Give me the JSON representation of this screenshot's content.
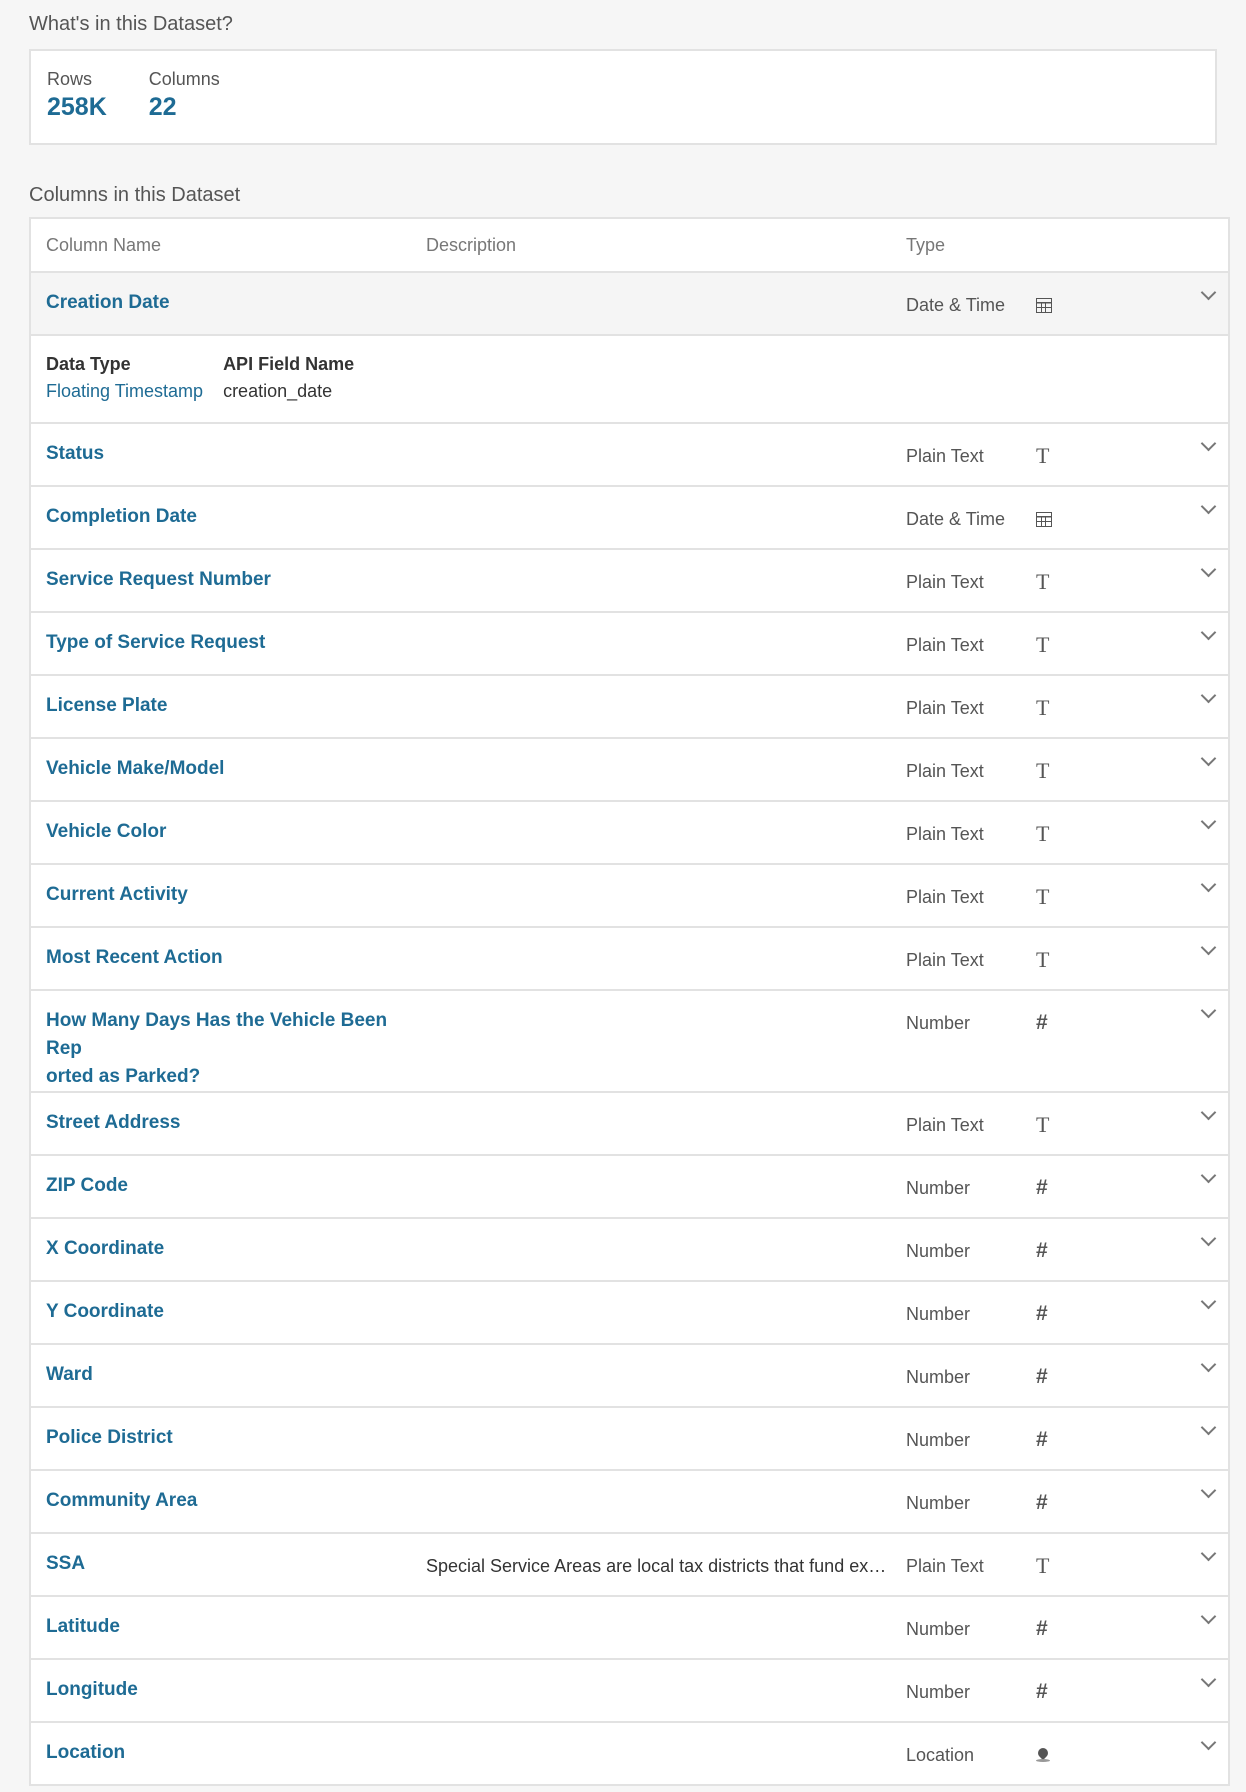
{
  "summary": {
    "heading": "What's in this Dataset?",
    "rows_label": "Rows",
    "rows_value": "258K",
    "columns_label": "Columns",
    "columns_value": "22"
  },
  "columns_section": {
    "heading": "Columns in this Dataset",
    "header": {
      "name": "Column Name",
      "description": "Description",
      "type": "Type"
    },
    "expanded_detail": {
      "data_type_label": "Data Type",
      "data_type_value": "Floating Timestamp",
      "api_field_label": "API Field Name",
      "api_field_value": "creation_date"
    },
    "rows": [
      {
        "name": "Creation Date",
        "description": "",
        "type": "Date & Time",
        "icon": "calendar-icon"
      },
      {
        "name": "Status",
        "description": "",
        "type": "Plain Text",
        "icon": "text-icon"
      },
      {
        "name": "Completion Date",
        "description": "",
        "type": "Date & Time",
        "icon": "calendar-icon"
      },
      {
        "name": "Service Request Number",
        "description": "",
        "type": "Plain Text",
        "icon": "text-icon"
      },
      {
        "name": "Type of Service Request",
        "description": "",
        "type": "Plain Text",
        "icon": "text-icon"
      },
      {
        "name": "License Plate",
        "description": "",
        "type": "Plain Text",
        "icon": "text-icon"
      },
      {
        "name": "Vehicle Make/Model",
        "description": "",
        "type": "Plain Text",
        "icon": "text-icon"
      },
      {
        "name": "Vehicle Color",
        "description": "",
        "type": "Plain Text",
        "icon": "text-icon"
      },
      {
        "name": "Current Activity",
        "description": "",
        "type": "Plain Text",
        "icon": "text-icon"
      },
      {
        "name": "Most Recent Action",
        "description": "",
        "type": "Plain Text",
        "icon": "text-icon"
      },
      {
        "name": "How Many Days Has the Vehicle Been Rep orted as Parked?",
        "name_line1": "How Many Days Has the Vehicle Been Rep",
        "name_line2": "orted as Parked?",
        "description": "",
        "type": "Number",
        "icon": "hash-icon"
      },
      {
        "name": "Street Address",
        "description": "",
        "type": "Plain Text",
        "icon": "text-icon"
      },
      {
        "name": "ZIP Code",
        "description": "",
        "type": "Number",
        "icon": "hash-icon"
      },
      {
        "name": "X Coordinate",
        "description": "",
        "type": "Number",
        "icon": "hash-icon"
      },
      {
        "name": "Y Coordinate",
        "description": "",
        "type": "Number",
        "icon": "hash-icon"
      },
      {
        "name": "Ward",
        "description": "",
        "type": "Number",
        "icon": "hash-icon"
      },
      {
        "name": "Police District",
        "description": "",
        "type": "Number",
        "icon": "hash-icon"
      },
      {
        "name": "Community Area",
        "description": "",
        "type": "Number",
        "icon": "hash-icon"
      },
      {
        "name": "SSA",
        "description": "Special Service Areas are local tax districts that fund expanded services and programs",
        "type": "Plain Text",
        "icon": "text-icon"
      },
      {
        "name": "Latitude",
        "description": "",
        "type": "Number",
        "icon": "hash-icon"
      },
      {
        "name": "Longitude",
        "description": "",
        "type": "Number",
        "icon": "hash-icon"
      },
      {
        "name": "Location",
        "description": "",
        "type": "Location",
        "icon": "location-pin-icon"
      }
    ]
  }
}
